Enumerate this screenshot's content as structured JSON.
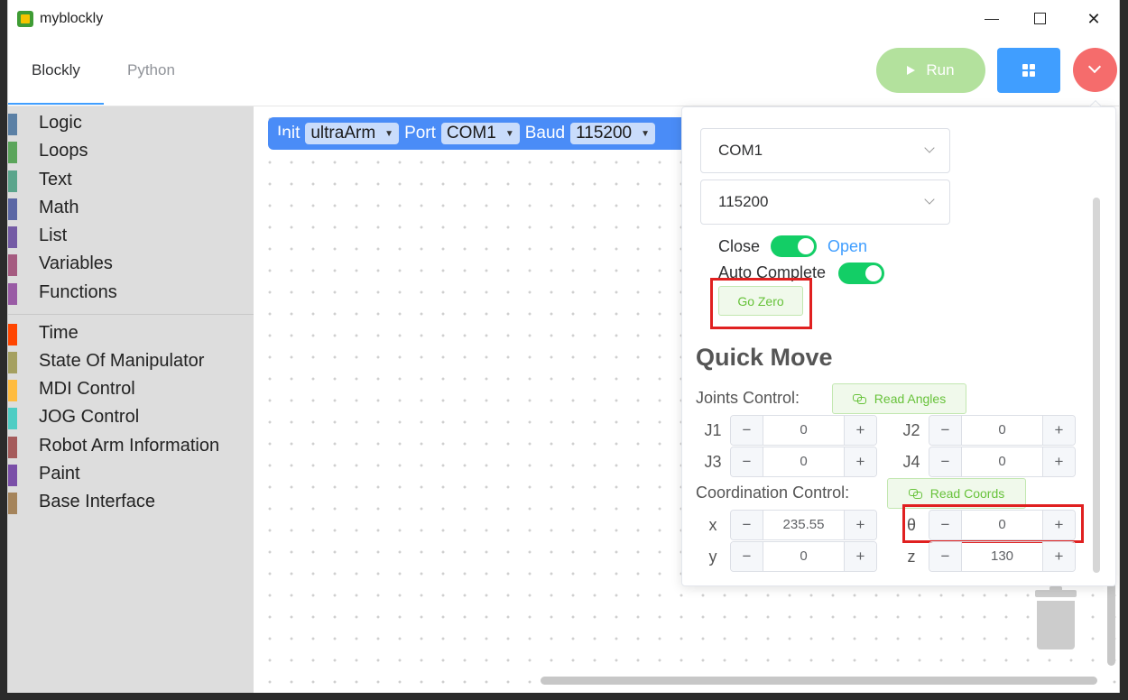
{
  "window": {
    "title": "myblockly",
    "icon": "app-icon"
  },
  "tabs": [
    {
      "label": "Blockly",
      "active": true
    },
    {
      "label": "Python",
      "active": false
    }
  ],
  "toolbar": {
    "run_label": "Run",
    "grid_icon": "grid-icon",
    "menu_icon": "chevron-down-icon"
  },
  "sidebar": {
    "categories": [
      {
        "label": "Logic",
        "color": "#5b80a5"
      },
      {
        "label": "Loops",
        "color": "#5ba55b"
      },
      {
        "label": "Text",
        "color": "#5ba58c"
      },
      {
        "label": "Math",
        "color": "#5b67a5"
      },
      {
        "label": "List",
        "color": "#745ba5"
      },
      {
        "label": "Variables",
        "color": "#a55b80"
      },
      {
        "label": "Functions",
        "color": "#995ba5"
      }
    ],
    "extra_categories": [
      {
        "label": "Time",
        "color": "#ff4500"
      },
      {
        "label": "State Of Manipulator",
        "color": "#a5a060"
      },
      {
        "label": "MDI Control",
        "color": "#ffbc40"
      },
      {
        "label": "JOG Control",
        "color": "#4ecdc4"
      },
      {
        "label": "Robot Arm Information",
        "color": "#a55b5b"
      },
      {
        "label": "Paint",
        "color": "#7a4fa8"
      },
      {
        "label": "Base Interface",
        "color": "#a5845b"
      }
    ]
  },
  "block": {
    "init": "Init",
    "device": "ultraArm",
    "port_label": "Port",
    "port": "COM1",
    "baud_label": "Baud",
    "baud": "115200"
  },
  "panel": {
    "port_select": "COM1",
    "baud_select": "115200",
    "close_label": "Close",
    "open_label": "Open",
    "auto_complete_label": "Auto Complete",
    "go_zero_label": "Go Zero",
    "quick_move_title": "Quick Move",
    "joints_label": "Joints Control:",
    "read_angles_label": "Read Angles",
    "coord_label": "Coordination Control:",
    "read_coords_label": "Read Coords",
    "joints": [
      {
        "label": "J1",
        "value": "0"
      },
      {
        "label": "J2",
        "value": "0"
      },
      {
        "label": "J3",
        "value": "0"
      },
      {
        "label": "J4",
        "value": "0"
      }
    ],
    "coords": [
      {
        "label": "x",
        "value": "235.55"
      },
      {
        "label": "θ",
        "value": "0"
      },
      {
        "label": "y",
        "value": "0"
      },
      {
        "label": "z",
        "value": "130"
      }
    ],
    "minus": "−",
    "plus": "+"
  }
}
